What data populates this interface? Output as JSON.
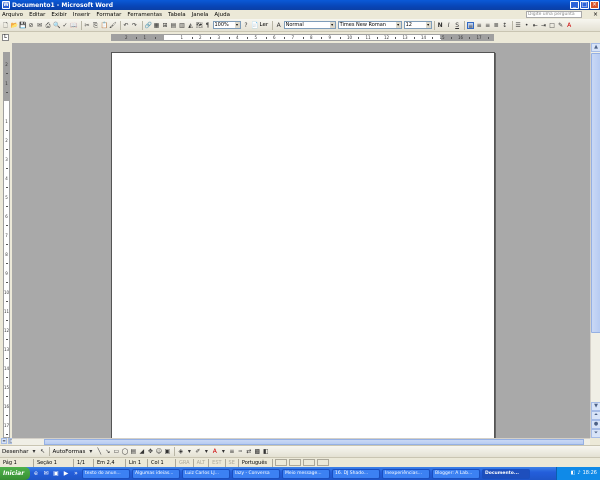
{
  "window": {
    "title": "Documento1 - Microsoft Word",
    "app_icon": "W",
    "min": "_",
    "max": "□",
    "close": "×"
  },
  "menu": {
    "items": [
      "Arquivo",
      "Editar",
      "Exibir",
      "Inserir",
      "Formatar",
      "Ferramentas",
      "Tabela",
      "Janela",
      "Ajuda"
    ],
    "help_placeholder": "Digite uma pergunta",
    "doc_close": "×"
  },
  "toolbar": {
    "zoom": "100%",
    "read_label": "Ler",
    "style": "Normal",
    "font": "Times New Roman",
    "size": "12",
    "bold": "N",
    "italic": "I",
    "underline": "S"
  },
  "ruler": {
    "corner": "L",
    "h_numbers": [
      "2",
      "1",
      "1",
      "2",
      "3",
      "4",
      "5",
      "6",
      "7",
      "8",
      "9",
      "10",
      "11",
      "12",
      "13",
      "14",
      "15",
      "16",
      "17",
      "18"
    ],
    "v_numbers": [
      "2",
      "1",
      "1",
      "2",
      "3",
      "4",
      "5",
      "6",
      "7",
      "8",
      "9",
      "10",
      "11",
      "12",
      "13",
      "14",
      "15",
      "16",
      "17"
    ]
  },
  "drawbar": {
    "draw_label": "Desenhar",
    "autoshapes_label": "AutoFormas"
  },
  "status": {
    "page": "Pág 1",
    "section": "Seção 1",
    "pages": "1/1",
    "position": "Em 2,4 cm",
    "line": "Lin 1",
    "column": "Col 1",
    "rec": "GRA",
    "trk": "ALT",
    "ext": "EST",
    "ovr": "SE",
    "language": "Português ("
  },
  "taskbar": {
    "start": "Iniciar",
    "tasks": [
      "texto do anun...",
      "Algumas ideias...",
      "Luiz Carlos LJ...",
      "lazy - Conversa",
      "Meio message...",
      "16. DJ Shado...",
      "Inexperiências...",
      "Blogger: A Lab...",
      "Documento..."
    ],
    "time": "18:26"
  }
}
